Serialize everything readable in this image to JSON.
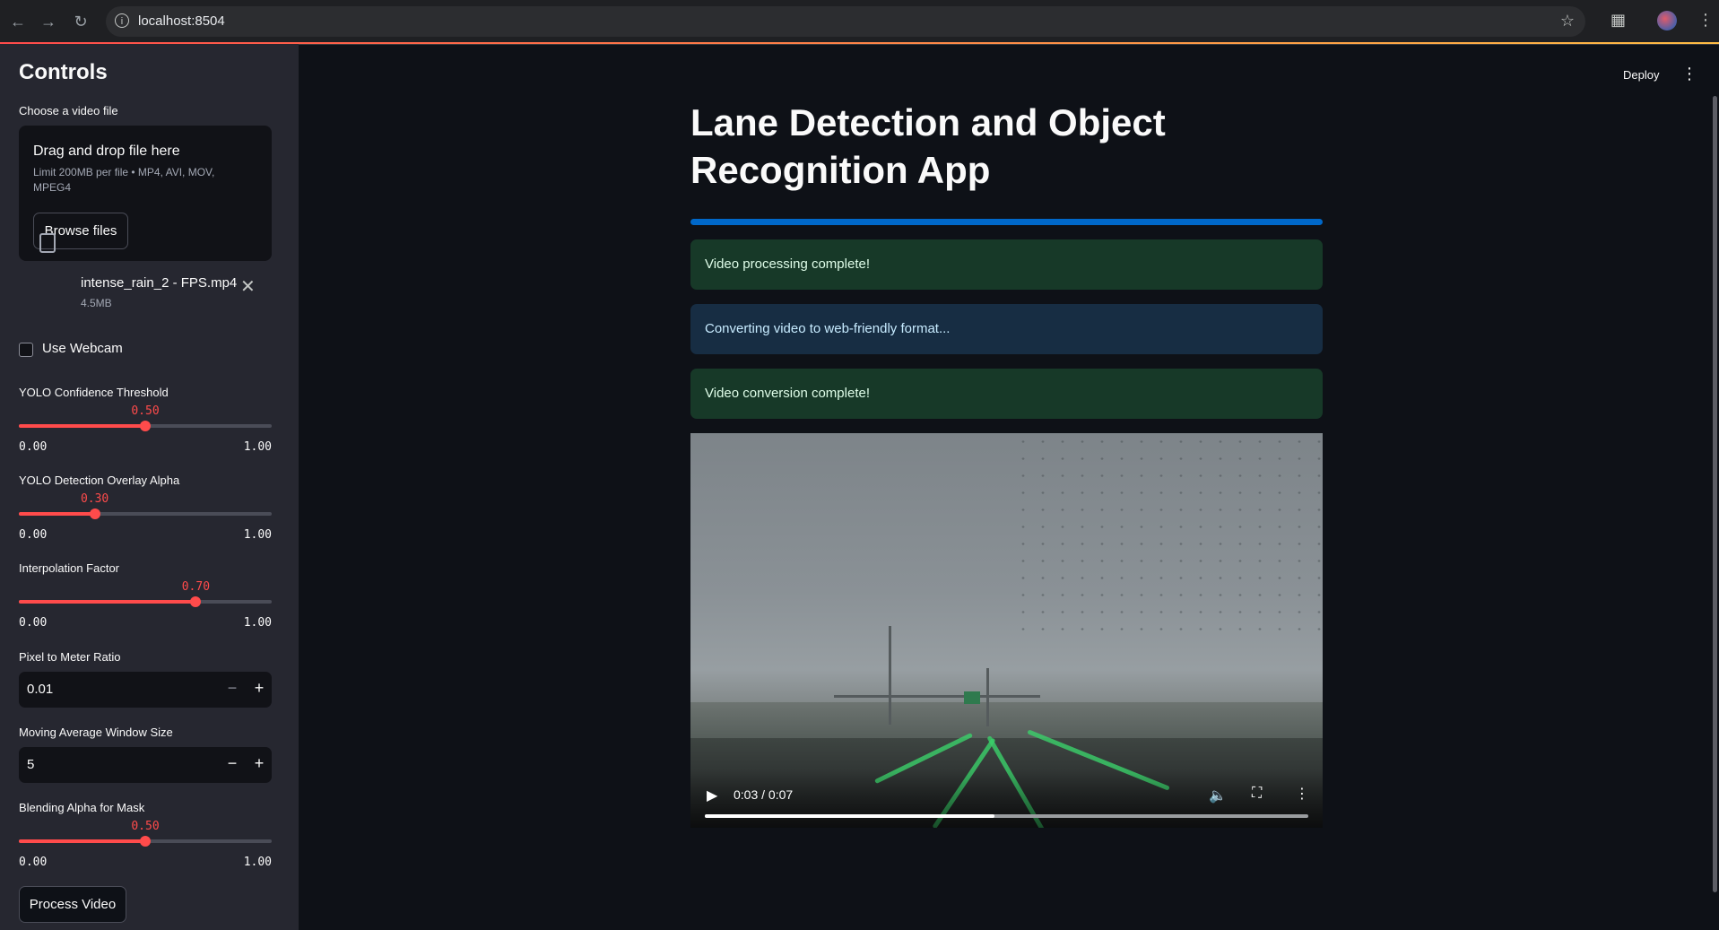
{
  "browser": {
    "url": "localhost:8504"
  },
  "sidebar": {
    "title": "Controls",
    "uploader": {
      "label": "Choose a video file",
      "drop_text": "Drag and drop file here",
      "limit_text": "Limit 200MB per file • MP4, AVI, MOV, MPEG4",
      "browse_label": "Browse files",
      "file_name": "intense_rain_2 - FPS.mp4",
      "file_size": "4.5MB"
    },
    "webcam": {
      "label": "Use Webcam",
      "checked": false
    },
    "sliders": [
      {
        "label": "YOLO Confidence Threshold",
        "value": "0.50",
        "fraction": 0.5,
        "min": "0.00",
        "max": "1.00"
      },
      {
        "label": "YOLO Detection Overlay Alpha",
        "value": "0.30",
        "fraction": 0.3,
        "min": "0.00",
        "max": "1.00"
      },
      {
        "label": "Interpolation Factor",
        "value": "0.70",
        "fraction": 0.7,
        "min": "0.00",
        "max": "1.00"
      }
    ],
    "pixel_ratio": {
      "label": "Pixel to Meter Ratio",
      "value": "0.01",
      "minus": "−",
      "plus": "+"
    },
    "moving_avg": {
      "label": "Moving Average Window Size",
      "value": "5",
      "minus": "−",
      "plus": "+"
    },
    "blend_slider": {
      "label": "Blending Alpha for Mask",
      "value": "0.50",
      "fraction": 0.5,
      "min": "0.00",
      "max": "1.00"
    },
    "process_label": "Process Video"
  },
  "main": {
    "deploy_label": "Deploy",
    "title": "Lane Detection and Object Recognition App",
    "progress": 1.0,
    "alerts": [
      {
        "type": "success",
        "text": "Video processing complete!"
      },
      {
        "type": "info",
        "text": "Converting video to web-friendly format..."
      },
      {
        "type": "success",
        "text": "Video conversion complete!"
      }
    ],
    "video": {
      "time": "0:03 / 0:07",
      "progress": 0.48
    }
  },
  "colors": {
    "accent": "#ff4b4b",
    "progress": "#0068c9",
    "success_bg": "#173928",
    "info_bg": "#172d43"
  },
  "icons": [
    "back-icon",
    "forward-icon",
    "reload-icon",
    "info-icon",
    "star-icon",
    "extensions-icon",
    "more-icon",
    "file-icon",
    "close-icon",
    "play-icon",
    "volume-icon",
    "fullscreen-icon"
  ]
}
